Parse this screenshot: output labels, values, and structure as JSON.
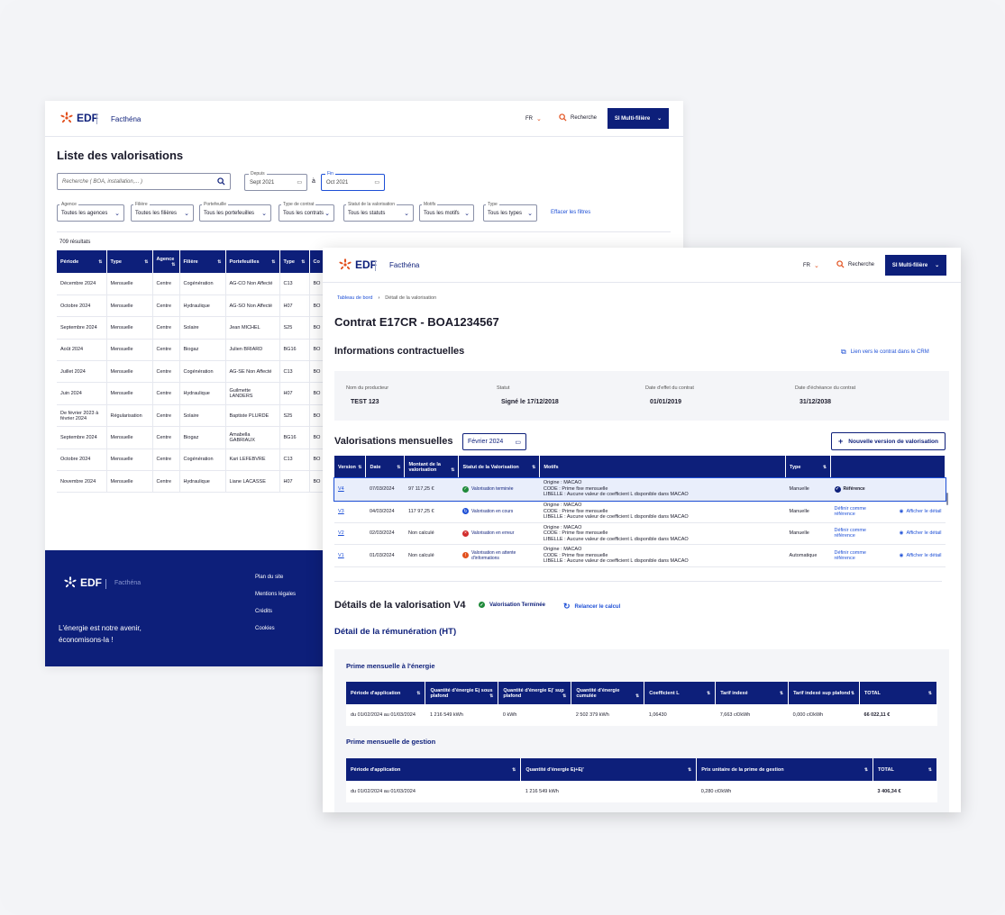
{
  "brand": {
    "logo": "EDF",
    "app": "Facthéna",
    "lang": "FR",
    "search": "Recherche",
    "si": "SI Multi-filière"
  },
  "list": {
    "title": "Liste des valorisations",
    "search_placeholder": "Recherche ( BOA, installation,... )",
    "depuis_label": "Depuis",
    "depuis_value": "Sept 2021",
    "a": "à",
    "fin_label": "Fin",
    "fin_value": "Oct 2021",
    "filters": [
      {
        "label": "Agence",
        "value": "Toutes les agences"
      },
      {
        "label": "Filière",
        "value": "Toutes les filières"
      },
      {
        "label": "Portefeuille",
        "value": "Tous les portefeuilles"
      },
      {
        "label": "Type de contrat",
        "value": "Tous les contrats"
      },
      {
        "label": "Statut de la valorisation",
        "value": "Tous les statuts"
      },
      {
        "label": "Motifs",
        "value": "Tous les motifs"
      },
      {
        "label": "Type",
        "value": "Tous les types"
      }
    ],
    "clear": "Effacer les filtres",
    "results": "709 résultats",
    "headers": [
      "Période",
      "Type",
      "Agence",
      "Filière",
      "Portefeuilles",
      "Type",
      "Co"
    ],
    "rows": [
      [
        "Décembre 2024",
        "Mensuelle",
        "Centre",
        "Cogénération",
        "AG-CO Non Affecté",
        "C13",
        "BO"
      ],
      [
        "Octobre 2024",
        "Mensuelle",
        "Centre",
        "Hydraulique",
        "AG-SO Non Affecté",
        "H07",
        "BO"
      ],
      [
        "Septembre 2024",
        "Mensuelle",
        "Centre",
        "Solaire",
        "Jean MICHEL",
        "S25",
        "BO"
      ],
      [
        "Août 2024",
        "Mensuelle",
        "Centre",
        "Biogaz",
        "Julien BRIARD",
        "BG16",
        "BO"
      ],
      [
        "Juillet 2024",
        "Mensuelle",
        "Centre",
        "Cogénération",
        "AG-SE Non Affecté",
        "C13",
        "BO"
      ],
      [
        "Juin 2024",
        "Mensuelle",
        "Centre",
        "Hydraulique",
        "Guilmette LANDERS",
        "H07",
        "BO"
      ],
      [
        "De février 2023 à février 2024",
        "Régularisation",
        "Centre",
        "Solaire",
        "Baptiste PLURDE",
        "S25",
        "BO"
      ],
      [
        "Septembre 2024",
        "Mensuelle",
        "Centre",
        "Biogaz",
        "Amabella GABRIAUX",
        "BG16",
        "BO"
      ],
      [
        "Octobre 2024",
        "Mensuelle",
        "Centre",
        "Cogénération",
        "Kari LEFEBVRE",
        "C13",
        "BO"
      ],
      [
        "Novembre 2024",
        "Mensuelle",
        "Centre",
        "Hydraulique",
        "Liane LACASSE",
        "H07",
        "BO"
      ]
    ]
  },
  "footer": {
    "links": [
      "Plan du site",
      "Mentions légales",
      "Crédits",
      "Cookies"
    ],
    "tagline1": "L'énergie est notre avenir,",
    "tagline2": "économisons-la !"
  },
  "detail": {
    "breadcrumb": [
      "Tableau de bord",
      "Détail de la valorisation"
    ],
    "title": "Contrat E17CR - BOA1234567",
    "info_title": "Informations contractuelles",
    "crm_link": "Lien vers le contrat dans le CRM",
    "info": [
      {
        "label": "Nom du producteur",
        "value": "TEST 123"
      },
      {
        "label": "Statut",
        "value": "Signé le 17/12/2018"
      },
      {
        "label": "Date d'effet du contrat",
        "value": "01/01/2019"
      },
      {
        "label": "Date d'échéance du contrat",
        "value": "31/12/2038"
      }
    ],
    "val_title": "Valorisations mensuelles",
    "month": "Février 2024",
    "new_btn": "Nouvelle version de valorisation",
    "vheaders": [
      "Version",
      "Date",
      "Montant de la valorisation",
      "Statut de la Valorisation",
      "Motifs",
      "Type",
      ""
    ],
    "vrows": [
      {
        "v": "V4",
        "date": "07/03/2024",
        "amount": "97 117,25 €",
        "status": "Valorisation terminée",
        "scolor": "#1f8a3a",
        "sym": "✓",
        "m1": "Origine : MACAO",
        "m2": "CODE : Prime fixe mensuelle",
        "m3": "LIBELLE : Aucune valeur de coefficient L disponible dans MACAO",
        "type": "Manuelle",
        "a1": "Référence",
        "a2": ""
      },
      {
        "v": "V3",
        "date": "04/03/2024",
        "amount": "117 97,25 €",
        "status": "Valorisation en cours",
        "scolor": "#1d4fd6",
        "sym": "↻",
        "m1": "Origine : MACAO",
        "m2": "CODE : Prime fixe mensuelle",
        "m3": "LIBELLE : Aucune valeur de coefficient L disponible dans MACAO",
        "type": "Manuelle",
        "a1": "Définir comme référence",
        "a2": "Afficher le détail"
      },
      {
        "v": "V2",
        "date": "02/03/2024",
        "amount": "Non calculé",
        "status": "Valorisation en erreur",
        "scolor": "#d12c2c",
        "sym": "×",
        "m1": "Origine : MACAO",
        "m2": "CODE : Prime fixe mensuelle",
        "m3": "LIBELLE : Aucune valeur de coefficient L disponible dans MACAO",
        "type": "Manuelle",
        "a1": "Définir comme référence",
        "a2": "Afficher le détail"
      },
      {
        "v": "V1",
        "date": "01/03/2024",
        "amount": "Non calculé",
        "status": "Valorisation en attente d'informations",
        "scolor": "#e2501d",
        "sym": "!",
        "m1": "Origine : MACAO",
        "m2": "CODE : Prime fixe mensuelle",
        "m3": "LIBELLE : Aucune valeur de coefficient L disponible dans MACAO",
        "type": "Automatique",
        "a1": "Définir comme référence",
        "a2": "Afficher le détail"
      }
    ],
    "det_title": "Détails de la valorisation V4",
    "det_status": "Valorisation Terminée",
    "relaunch": "Relancer le calcul",
    "rem_title": "Détail de la rémunération (HT)",
    "prime1_title": "Prime mensuelle à l'énergie",
    "p1headers": [
      "Période d'application",
      "Quantité d'énergie Ej sous plafond",
      "Quantité d'énergie Ej' sup plafond",
      "Quantité d'énergie cumulée",
      "Coefficient L",
      "Tarif indexé",
      "Tarif indexé sup plafond",
      "TOTAL"
    ],
    "p1row": [
      "du 01/02/2024 au 01/03/2024",
      "1 216 549 kWh",
      "0 kWh",
      "2 502 379  kWh",
      "1,06430",
      "7,663 c€/kWh",
      "0,000 c€/kWh",
      "66 022,11 €"
    ],
    "prime2_title": "Prime mensuelle de gestion",
    "p2headers": [
      "Période d'application",
      "Quantité d'énergie Ej+Ej'",
      "Prix unitaire de la prime de gestion",
      "TOTAL"
    ],
    "p2row": [
      "du 01/02/2024 au 01/03/2024",
      "1 216 549 kWh",
      "0,280 c€/kWh",
      "3 406,34 €"
    ]
  }
}
